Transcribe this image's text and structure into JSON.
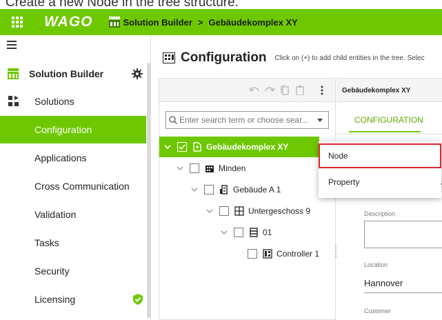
{
  "caption": "Create a new Node in the tree structure.",
  "topbar": {
    "logo": "WAGO",
    "app_name": "Solution Builder",
    "breadcrumb_separator": ">",
    "current_project": "Gebäudekomplex XY"
  },
  "sidebar": {
    "title": "Solution Builder",
    "items": [
      {
        "label": "Solutions",
        "icon": "solutions-icon",
        "active": false
      },
      {
        "label": "Configuration",
        "active": true
      },
      {
        "label": "Applications",
        "active": false
      },
      {
        "label": "Cross Communication",
        "active": false
      },
      {
        "label": "Validation",
        "active": false
      },
      {
        "label": "Tasks",
        "active": false
      },
      {
        "label": "Security",
        "active": false
      },
      {
        "label": "Licensing",
        "active": false,
        "badge_icon": "shield-check-icon"
      }
    ]
  },
  "main": {
    "title": "Configuration",
    "hint": "Click on (+) to add child entities in the tree. Selec"
  },
  "tree": {
    "search_placeholder": "Enter search term or choose sear...",
    "toolbar_icons": [
      "undo-icon",
      "redo-icon",
      "copy-icon",
      "paste-icon",
      "more-vertical-icon"
    ],
    "nodes": [
      {
        "label": "Gebäudekomplex XY",
        "selected": true,
        "checked": true,
        "icon": "building-node-icon"
      },
      {
        "label": "Minden",
        "icon": "city-icon"
      },
      {
        "label": "Gebäude A 1",
        "icon": "building-icon"
      },
      {
        "label": "Untergeschoss 9",
        "icon": "floor-icon"
      },
      {
        "label": "01",
        "icon": "room-icon"
      },
      {
        "label": "Controller 1",
        "icon": "controller-icon"
      }
    ]
  },
  "detail": {
    "header": "Gebäudekomplex XY",
    "tab": "CONFIGURATION",
    "name_value_fragment": "Y",
    "description_label": "Description",
    "description_value": "",
    "location_label": "Location",
    "location_value": "Hannover",
    "customer_label": "Customer"
  },
  "context_menu": {
    "items": [
      "Node",
      "Property"
    ]
  },
  "colors": {
    "brand_green": "#6ec800",
    "highlight_red": "#e2262c"
  }
}
